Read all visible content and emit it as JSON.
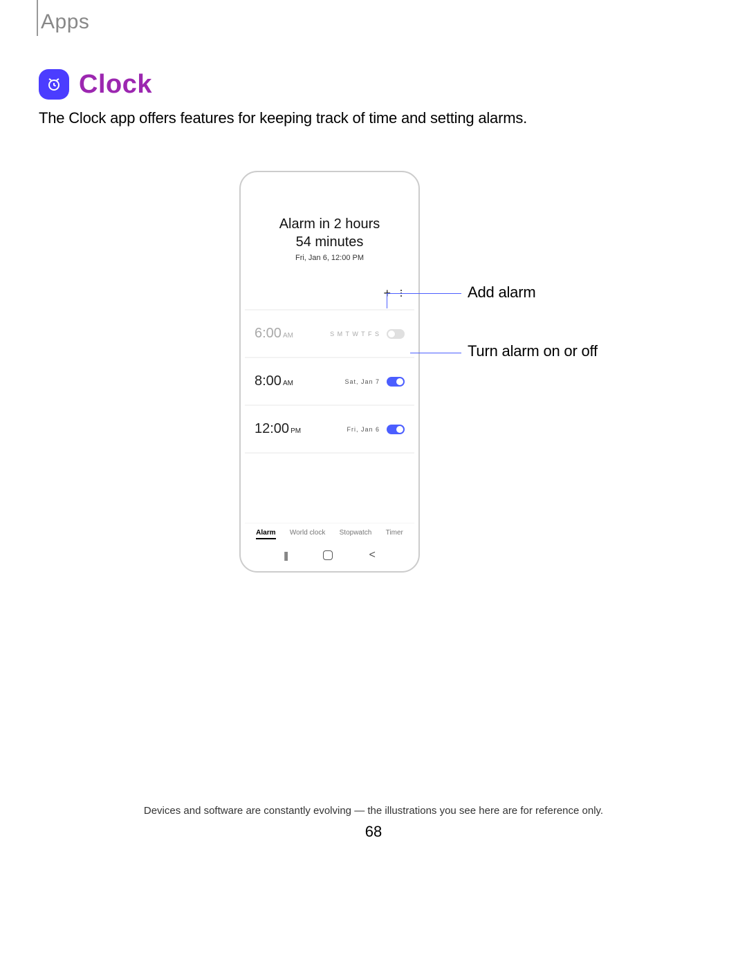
{
  "section": "Apps",
  "title": "Clock",
  "description": "The Clock app offers features for keeping track of time and setting alarms.",
  "callouts": {
    "add_alarm": "Add alarm",
    "toggle": "Turn alarm on or off"
  },
  "phone": {
    "header_line1": "Alarm in 2 hours",
    "header_line2": "54 minutes",
    "header_sub": "Fri, Jan 6, 12:00 PM",
    "alarms": [
      {
        "time": "6:00",
        "ampm": "AM",
        "days": "S M T W T F S",
        "on": false
      },
      {
        "time": "8:00",
        "ampm": "AM",
        "days": "Sat, Jan 7",
        "on": true
      },
      {
        "time": "12:00",
        "ampm": "PM",
        "days": "Fri, Jan 6",
        "on": true
      }
    ],
    "tabs": [
      "Alarm",
      "World clock",
      "Stopwatch",
      "Timer"
    ]
  },
  "disclaimer": "Devices and software are constantly evolving — the illustrations you see here are for reference only.",
  "page_number": "68"
}
